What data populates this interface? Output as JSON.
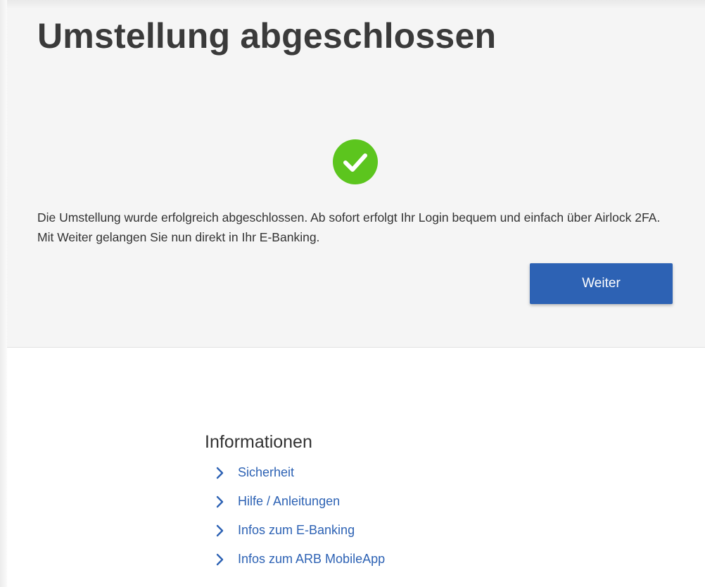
{
  "page": {
    "title": "Umstellung abgeschlossen",
    "message": "Die Umstellung wurde erfolgreich abgeschlossen. Ab sofort erfolgt Ihr Login bequem und einfach über Airlock 2FA. Mit Weiter gelangen Sie nun direkt in Ihr E-Banking.",
    "continue_label": "Weiter",
    "success_icon": "check-circle-icon"
  },
  "info": {
    "heading": "Informationen",
    "links": [
      {
        "label": "Sicherheit"
      },
      {
        "label": "Hilfe / Anleitungen"
      },
      {
        "label": "Infos zum E-Banking"
      },
      {
        "label": "Infos zum ARB MobileApp"
      }
    ]
  },
  "colors": {
    "accent": "#2d62b4",
    "success": "#5cc51e",
    "panel_bg": "#f5f5f5",
    "text": "#333333"
  }
}
